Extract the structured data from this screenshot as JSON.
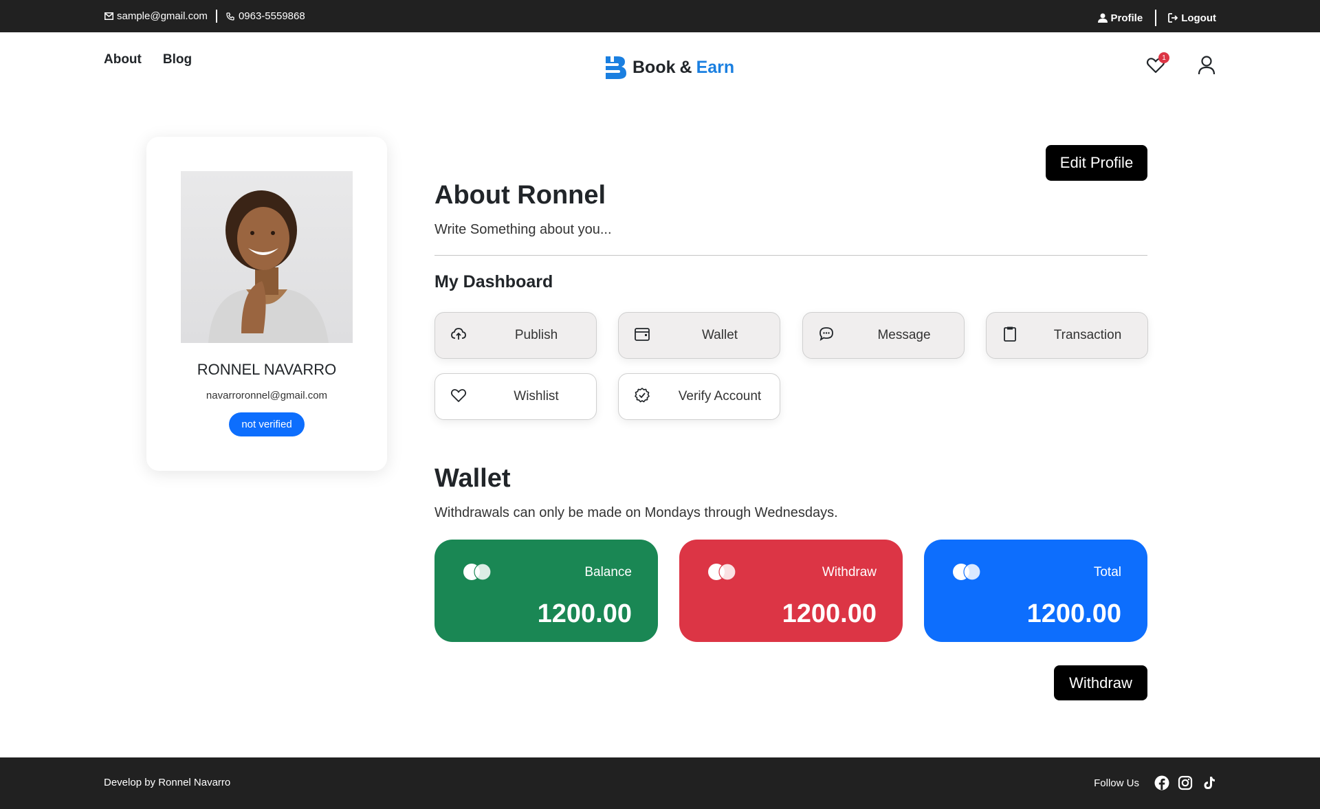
{
  "topbar": {
    "email": "sample@gmail.com",
    "phone": "0963-5559868",
    "profile_label": "Profile",
    "logout_label": "Logout"
  },
  "nav": {
    "links": [
      "About",
      "Blog"
    ],
    "brand_part1": "Book",
    "brand_amp": "&",
    "brand_part2": "Earn",
    "wishlist_count": "1"
  },
  "profile": {
    "name": "RONNEL NAVARRO",
    "email": "navarroronnel@gmail.com",
    "status": "not verified"
  },
  "about": {
    "edit_label": "Edit Profile",
    "title": "About Ronnel",
    "text": "Write Something about you..."
  },
  "dashboard": {
    "title": "My Dashboard",
    "buttons": [
      {
        "label": "Publish",
        "icon": "cloud-upload-icon"
      },
      {
        "label": "Wallet",
        "icon": "wallet-icon"
      },
      {
        "label": "Message",
        "icon": "chat-icon"
      },
      {
        "label": "Transaction",
        "icon": "clipboard-icon"
      },
      {
        "label": "Wishlist",
        "icon": "heart-icon"
      },
      {
        "label": "Verify Account",
        "icon": "verified-badge-icon"
      }
    ]
  },
  "wallet": {
    "title": "Wallet",
    "note": "Withdrawals can only be made on Mondays through Wednesdays.",
    "cards": [
      {
        "label": "Balance",
        "value": "1200.00",
        "color": "#1a8754"
      },
      {
        "label": "Withdraw",
        "value": "1200.00",
        "color": "#dc3545"
      },
      {
        "label": "Total",
        "value": "1200.00",
        "color": "#0d6efd"
      }
    ],
    "withdraw_label": "Withdraw"
  },
  "footer": {
    "credit": "Develop by Ronnel Navarro",
    "follow": "Follow Us",
    "social": [
      "facebook-icon",
      "instagram-icon",
      "tiktok-icon"
    ]
  },
  "colors": {
    "brand_blue": "#1a7fe0",
    "dark_bar": "#212121",
    "badge_red": "#dc3545"
  }
}
